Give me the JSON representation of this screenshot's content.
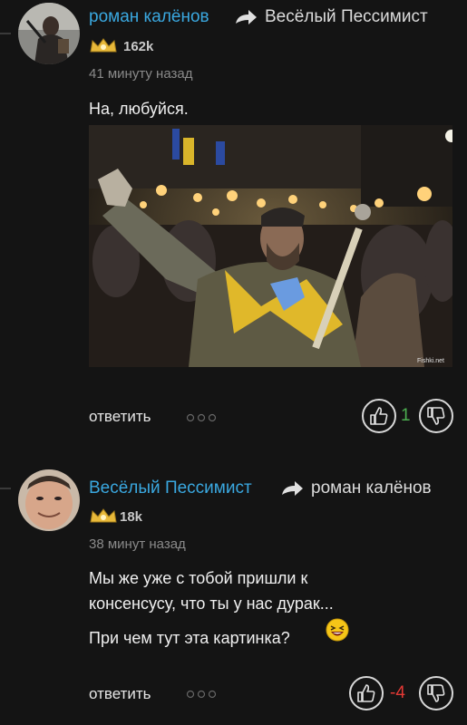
{
  "comments": [
    {
      "author": "роман калёнов",
      "recipient": "Весёлый Пессимист",
      "rating": "162k",
      "time": "41 минуту назад",
      "text": "На, любуйся.",
      "image_watermark": "Fishki.net",
      "reply_label": "ответить",
      "score": "1",
      "score_color": "#4caf50"
    },
    {
      "author": "Весёлый Пессимист",
      "recipient": "роман калёнов",
      "rating": "18k",
      "time": "38 минут назад",
      "text_lines": [
        "Мы же уже с тобой пришли к",
        "консенсусу, что ты у нас дурак..."
      ],
      "text2": "При чем тут эта картинка?",
      "emoji": "laughing-emoji",
      "reply_label": "ответить",
      "score": "-4",
      "score_color": "#e53935"
    }
  ],
  "colors": {
    "background": "#141414",
    "author": "#3aa8e0",
    "badge": "#e8b93a"
  }
}
